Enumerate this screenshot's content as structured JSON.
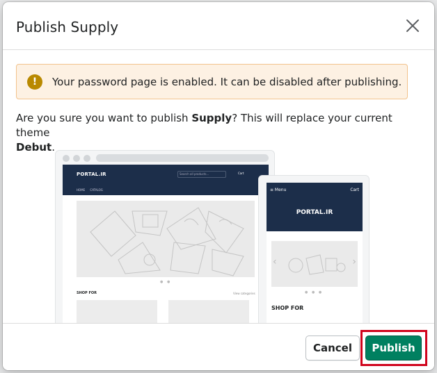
{
  "modal": {
    "title": "Publish Supply",
    "close_icon": "close-icon"
  },
  "banner": {
    "icon": "warning-icon",
    "icon_glyph": "!",
    "text": "Your password page is enabled. It can be disabled after publishing.",
    "accent": "#b98900"
  },
  "confirm": {
    "prefix": "Are you sure you want to publish ",
    "theme_name": "Supply",
    "middle": "? This will replace your current theme ",
    "current_theme": "Debut",
    "suffix": "."
  },
  "preview": {
    "desktop": {
      "logo": "PORTAL.IR",
      "search_placeholder": "Search all products...",
      "cart": "Cart",
      "nav_links": "HOME CATALOG",
      "shop_for": "SHOP FOR",
      "view_categories": "View categories"
    },
    "mobile": {
      "menu": "≡ Menu",
      "cart": "Cart",
      "logo": "PORTAL.IR",
      "shop_for": "SHOP FOR"
    }
  },
  "footer": {
    "cancel_label": "Cancel",
    "publish_label": "Publish",
    "primary_color": "#008060",
    "highlight_color": "#d0021b"
  }
}
